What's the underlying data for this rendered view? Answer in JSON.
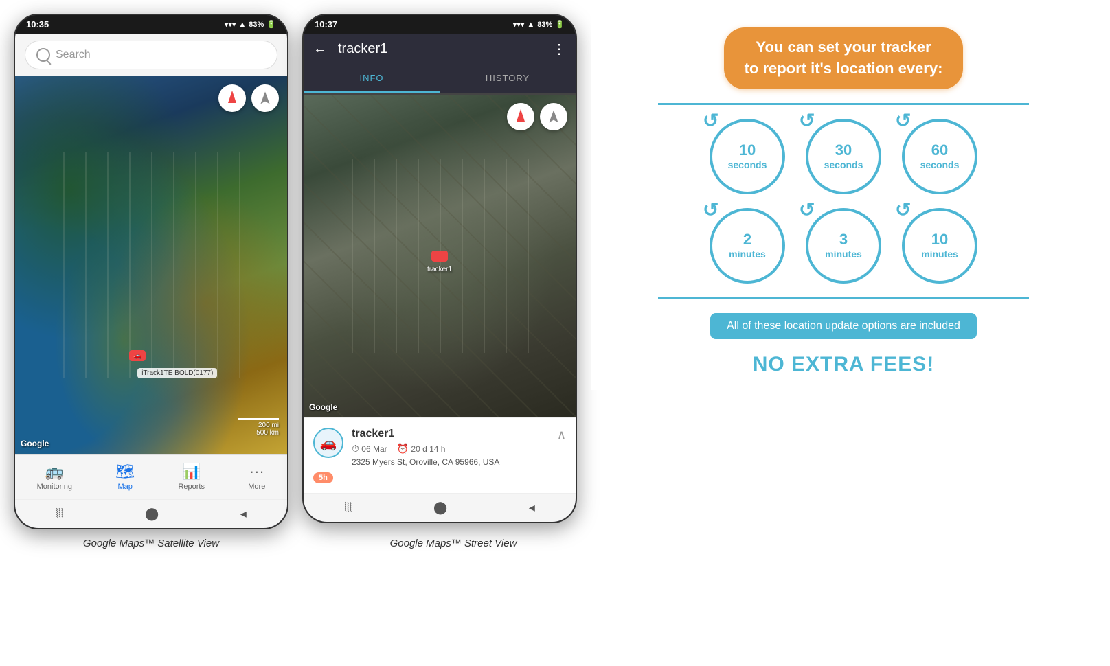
{
  "phone1": {
    "status_time": "10:35",
    "status_battery": "83%",
    "search_placeholder": "Search",
    "tracker_label": "iTrack1TE BOLD(0177)",
    "google_label": "Google",
    "scale_200mi": "200 mi",
    "scale_500km": "500 km",
    "nav_items": [
      {
        "label": "Monitoring",
        "icon": "🚌",
        "active": false
      },
      {
        "label": "Map",
        "icon": "🗺",
        "active": true
      },
      {
        "label": "Reports",
        "icon": "📊",
        "active": false
      },
      {
        "label": "More",
        "icon": "···",
        "active": false
      }
    ],
    "caption": "Google Maps™ Satellite View"
  },
  "phone2": {
    "status_time": "10:37",
    "status_battery": "83%",
    "title": "tracker1",
    "tabs": [
      {
        "label": "INFO",
        "active": true
      },
      {
        "label": "HISTORY",
        "active": false
      }
    ],
    "google_label": "Google",
    "tracker_info": {
      "name": "tracker1",
      "date": "06 Mar",
      "duration": "20 d 14 h",
      "address": "2325 Myers St, Oroville, CA 95966, USA",
      "badge": "5h"
    },
    "caption": "Google Maps™ Street View"
  },
  "infographic": {
    "title_line1": "You can set your tracker",
    "title_line2": "to report it's location every:",
    "circles": [
      {
        "number": "10",
        "unit": "seconds"
      },
      {
        "number": "30",
        "unit": "seconds"
      },
      {
        "number": "60",
        "unit": "seconds"
      },
      {
        "number": "2",
        "unit": "minutes"
      },
      {
        "number": "3",
        "unit": "minutes"
      },
      {
        "number": "10",
        "unit": "minutes"
      }
    ],
    "included_text": "All of these location update options are included",
    "no_fees_text": "NO EXTRA FEES!",
    "accent_color": "#e8943a",
    "blue_color": "#4db6d4"
  }
}
